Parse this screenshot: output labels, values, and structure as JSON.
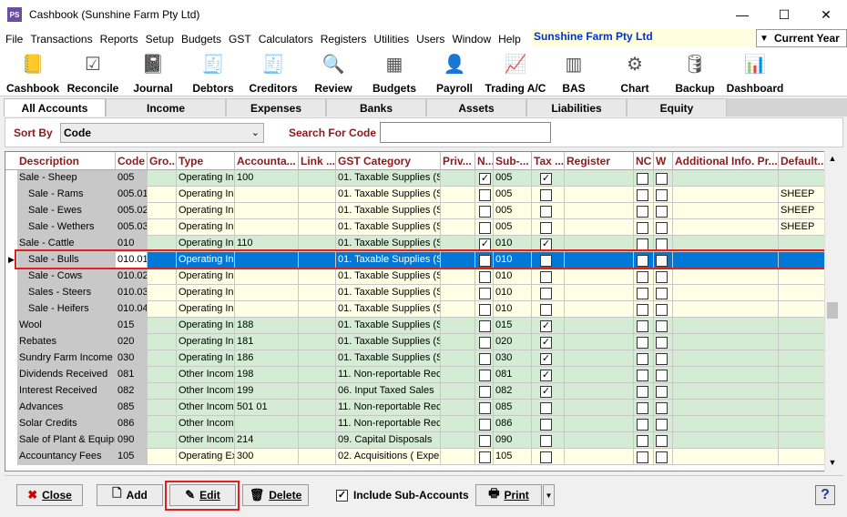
{
  "window": {
    "title": "Cashbook (Sunshine Farm Pty Ltd)",
    "icon_text": "PS",
    "minimize": "—",
    "maximize": "☐",
    "close": "✕"
  },
  "menus": [
    "File",
    "Transactions",
    "Reports",
    "Setup",
    "Budgets",
    "GST",
    "Calculators",
    "Registers",
    "Utilities",
    "Users",
    "Window",
    "Help"
  ],
  "company": {
    "name": "Sunshine Farm Pty Ltd",
    "period": "Current Year"
  },
  "toolbar": [
    {
      "label": "Cashbook",
      "icon": "cashbook-icon"
    },
    {
      "label": "Reconcile",
      "icon": "reconcile-icon"
    },
    {
      "label": "Journal",
      "icon": "journal-icon"
    },
    {
      "label": "Debtors",
      "icon": "debtors-icon"
    },
    {
      "label": "Creditors",
      "icon": "creditors-icon"
    },
    {
      "label": "Review",
      "icon": "review-icon"
    },
    {
      "label": "Budgets",
      "icon": "budgets-icon"
    },
    {
      "label": "Payroll",
      "icon": "payroll-icon"
    },
    {
      "label": "Trading A/C",
      "icon": "trading-icon"
    },
    {
      "label": "BAS",
      "icon": "bas-icon"
    },
    {
      "label": "Chart",
      "icon": "chart-icon"
    },
    {
      "label": "Backup",
      "icon": "backup-icon"
    },
    {
      "label": "Dashboard",
      "icon": "dashboard-icon"
    }
  ],
  "tabs": [
    "All Accounts",
    "Income",
    "Expenses",
    "Banks",
    "Assets",
    "Liabilities",
    "Equity"
  ],
  "sort": {
    "label": "Sort By",
    "value": "Code",
    "search_label": "Search For Code",
    "search_value": ""
  },
  "columns": [
    "Description",
    "Code",
    "Gro...",
    "Type",
    "Accounta...",
    "Link ...",
    "GST Category",
    "Priv...",
    "N...",
    "Sub-...",
    "Tax ...",
    "Register",
    "NC",
    "W",
    "Additional Info. Pr...",
    "Default..."
  ],
  "rows": [
    {
      "desc": "Sale - Sheep",
      "sub": false,
      "code": "005",
      "type": "Operating Inc",
      "acct": "100",
      "gst": "01. Taxable Supplies (S",
      "n": true,
      "subc": "005",
      "tax": true,
      "def": "",
      "color": "g"
    },
    {
      "desc": "Sale - Rams",
      "sub": true,
      "code": "005.01",
      "type": "Operating Inc",
      "acct": "",
      "gst": "01. Taxable Supplies (S",
      "n": false,
      "subc": "005",
      "tax": false,
      "def": "SHEEP",
      "color": "y"
    },
    {
      "desc": "Sale - Ewes",
      "sub": true,
      "code": "005.02",
      "type": "Operating Inc",
      "acct": "",
      "gst": "01. Taxable Supplies (S",
      "n": false,
      "subc": "005",
      "tax": false,
      "def": "SHEEP",
      "color": "y"
    },
    {
      "desc": "Sale - Wethers",
      "sub": true,
      "code": "005.03",
      "type": "Operating Inc",
      "acct": "",
      "gst": "01. Taxable Supplies (S",
      "n": false,
      "subc": "005",
      "tax": false,
      "def": "SHEEP",
      "color": "y"
    },
    {
      "desc": "Sale - Cattle",
      "sub": false,
      "code": "010",
      "type": "Operating Inc",
      "acct": "110",
      "gst": "01. Taxable Supplies (S",
      "n": true,
      "subc": "010",
      "tax": true,
      "def": "",
      "color": "g"
    },
    {
      "desc": "Sale - Bulls",
      "sub": true,
      "code": "010.01",
      "type": "Operating Inc",
      "acct": "",
      "gst": "01. Taxable Supplies (S",
      "n": false,
      "subc": "010",
      "tax": false,
      "def": "",
      "color": "sel"
    },
    {
      "desc": "Sale - Cows",
      "sub": true,
      "code": "010.02",
      "type": "Operating Inc",
      "acct": "",
      "gst": "01. Taxable Supplies (S",
      "n": false,
      "subc": "010",
      "tax": false,
      "def": "",
      "color": "y"
    },
    {
      "desc": "Sales - Steers",
      "sub": true,
      "code": "010.03",
      "type": "Operating Inc",
      "acct": "",
      "gst": "01. Taxable Supplies (S",
      "n": false,
      "subc": "010",
      "tax": false,
      "def": "",
      "color": "y"
    },
    {
      "desc": "Sale - Heifers",
      "sub": true,
      "code": "010.04",
      "type": "Operating Inc",
      "acct": "",
      "gst": "01. Taxable Supplies (S",
      "n": false,
      "subc": "010",
      "tax": false,
      "def": "",
      "color": "y"
    },
    {
      "desc": "Wool",
      "sub": false,
      "code": "015",
      "type": "Operating Inc",
      "acct": "188",
      "gst": "01. Taxable Supplies (S",
      "n": false,
      "subc": "015",
      "tax": true,
      "def": "",
      "color": "g"
    },
    {
      "desc": "Rebates",
      "sub": false,
      "code": "020",
      "type": "Operating Inc",
      "acct": "181",
      "gst": "01. Taxable Supplies (S",
      "n": false,
      "subc": "020",
      "tax": true,
      "def": "",
      "color": "g"
    },
    {
      "desc": "Sundry Farm Income",
      "sub": false,
      "code": "030",
      "type": "Operating Inc",
      "acct": "186",
      "gst": "01. Taxable Supplies (S",
      "n": false,
      "subc": "030",
      "tax": true,
      "def": "",
      "color": "g"
    },
    {
      "desc": "Dividends Received",
      "sub": false,
      "code": "081",
      "type": "Other Income",
      "acct": "198",
      "gst": "11. Non-reportable Rec",
      "n": false,
      "subc": "081",
      "tax": true,
      "def": "",
      "color": "g"
    },
    {
      "desc": "Interest Received",
      "sub": false,
      "code": "082",
      "type": "Other Income",
      "acct": "199",
      "gst": "06. Input Taxed Sales",
      "n": false,
      "subc": "082",
      "tax": true,
      "def": "",
      "color": "g"
    },
    {
      "desc": "Advances",
      "sub": false,
      "code": "085",
      "type": "Other Income",
      "acct": "501 01",
      "gst": "11. Non-reportable Rec",
      "n": false,
      "subc": "085",
      "tax": false,
      "def": "",
      "color": "g"
    },
    {
      "desc": "Solar Credits",
      "sub": false,
      "code": "086",
      "type": "Other Income",
      "acct": "",
      "gst": "11. Non-reportable Rec",
      "n": false,
      "subc": "086",
      "tax": false,
      "def": "",
      "color": "g"
    },
    {
      "desc": "Sale of Plant & Equipm",
      "sub": false,
      "code": "090",
      "type": "Other Income",
      "acct": "214",
      "gst": "09. Capital Disposals",
      "n": false,
      "subc": "090",
      "tax": false,
      "def": "",
      "color": "g"
    },
    {
      "desc": "Accountancy Fees",
      "sub": false,
      "code": "105",
      "type": "Operating Ex",
      "acct": "300",
      "gst": "02. Acquisitions ( Exper",
      "n": false,
      "subc": "105",
      "tax": false,
      "def": "",
      "color": "y"
    }
  ],
  "bottom": {
    "close": "Close",
    "add": "Add",
    "edit": "Edit",
    "delete": "Delete",
    "include_sub": "Include Sub-Accounts",
    "include_sub_checked": true,
    "print": "Print",
    "help": "?"
  }
}
